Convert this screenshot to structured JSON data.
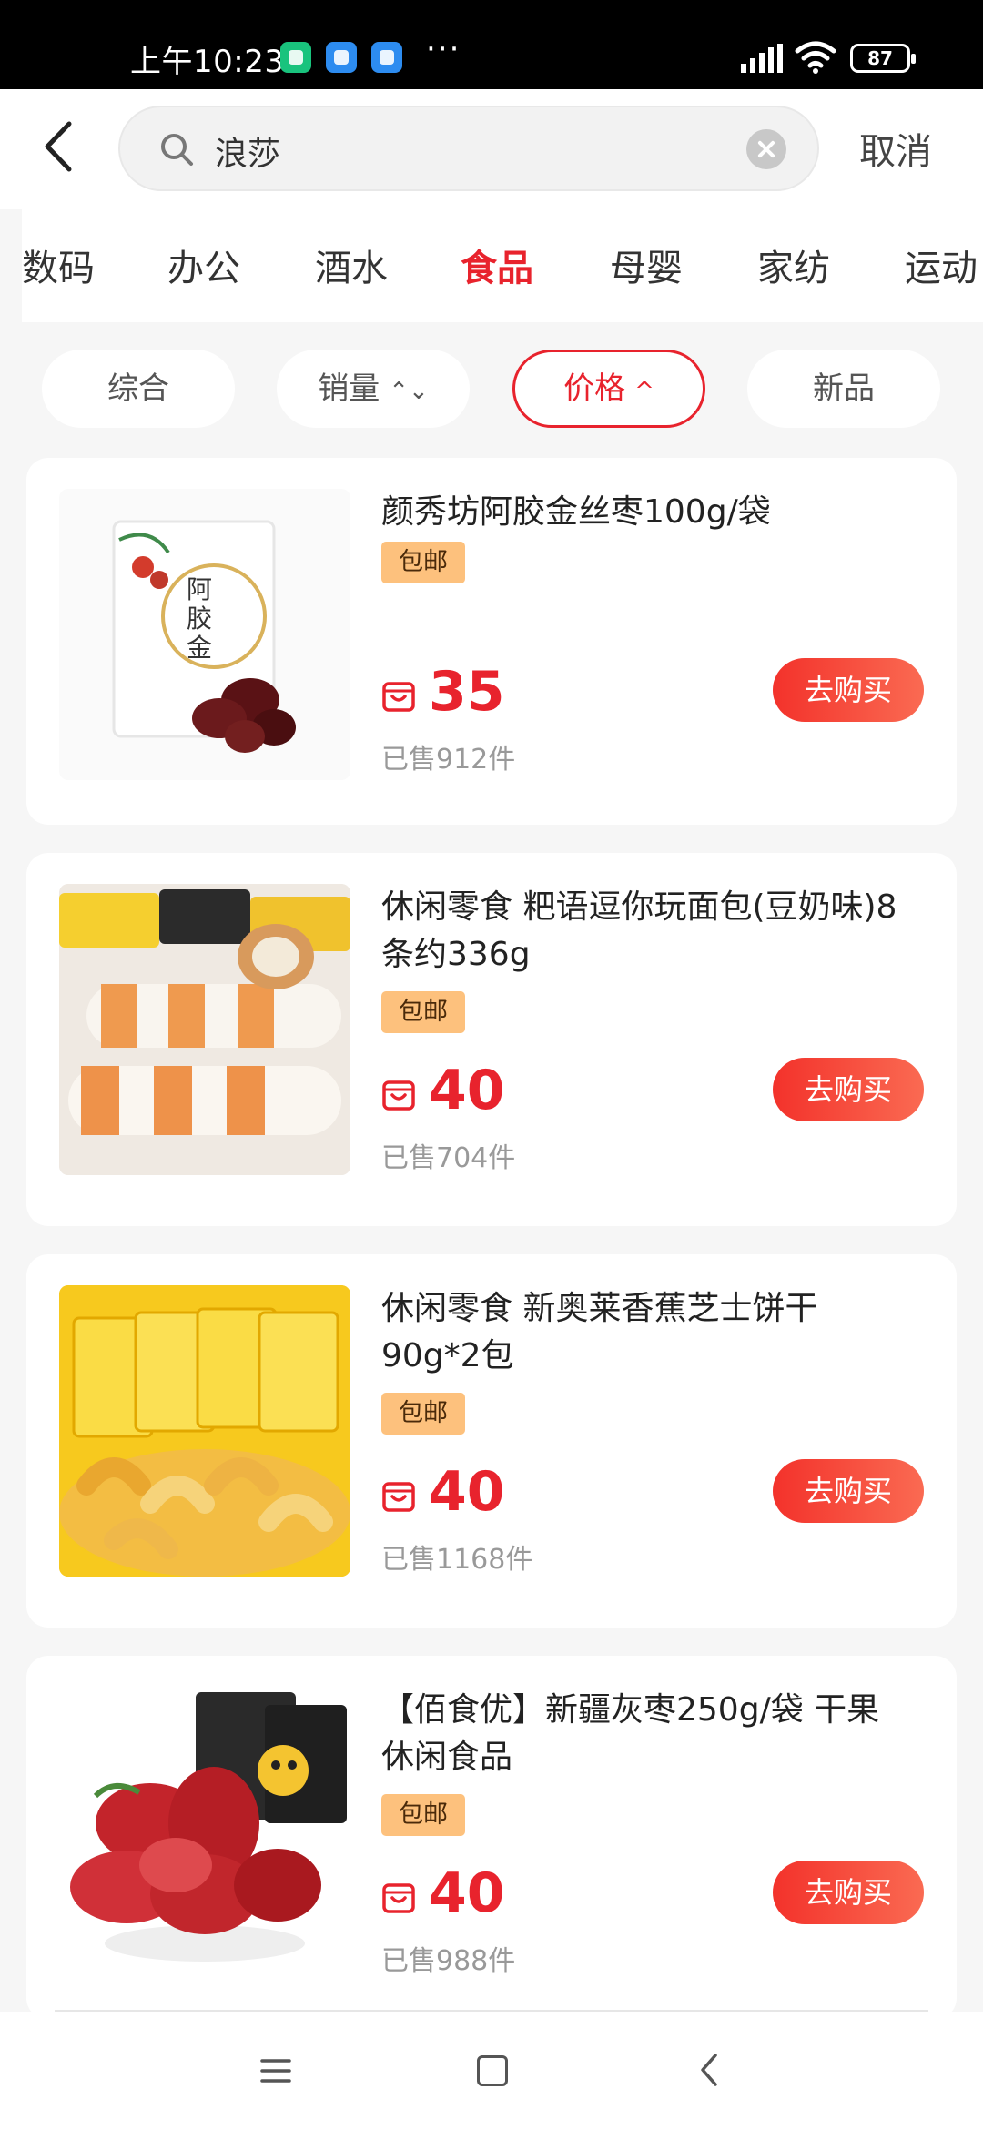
{
  "status_bar": {
    "time": "上午10:23",
    "dots": "···",
    "battery": "87",
    "icons": [
      "signal-icon",
      "wifi-icon",
      "battery-icon"
    ]
  },
  "search": {
    "query": "浪莎",
    "cancel_label": "取消"
  },
  "categories": [
    {
      "label": "数码"
    },
    {
      "label": "办公"
    },
    {
      "label": "酒水"
    },
    {
      "label": "食品",
      "active": true
    },
    {
      "label": "母婴"
    },
    {
      "label": "家纺"
    },
    {
      "label": "运动"
    }
  ],
  "sort": [
    {
      "label": "综合"
    },
    {
      "label": "销量",
      "arrow": "⌃⌄"
    },
    {
      "label": "价格",
      "arrow": "^",
      "active": true
    },
    {
      "label": "新品"
    }
  ],
  "products": [
    {
      "title": "颜秀坊阿胶金丝枣100g/袋",
      "badge": "包邮",
      "price": "35",
      "sold": "已售912件",
      "buy_label": "去购买"
    },
    {
      "title": "休闲零食 粑语逗你玩面包(豆奶味)8条约336g",
      "badge": "包邮",
      "price": "40",
      "sold": "已售704件",
      "buy_label": "去购买"
    },
    {
      "title": "休闲零食 新奥莱香蕉芝士饼干90g*2包",
      "badge": "包邮",
      "price": "40",
      "sold": "已售1168件",
      "buy_label": "去购买"
    },
    {
      "title": "【佰食优】新疆灰枣250g/袋 干果休闲食品",
      "badge": "包邮",
      "price": "40",
      "sold": "已售988件",
      "buy_label": "去购买"
    }
  ],
  "colors": {
    "accent": "#e8232d",
    "badge_bg": "#fdc17d",
    "background": "#f6f6f6"
  }
}
